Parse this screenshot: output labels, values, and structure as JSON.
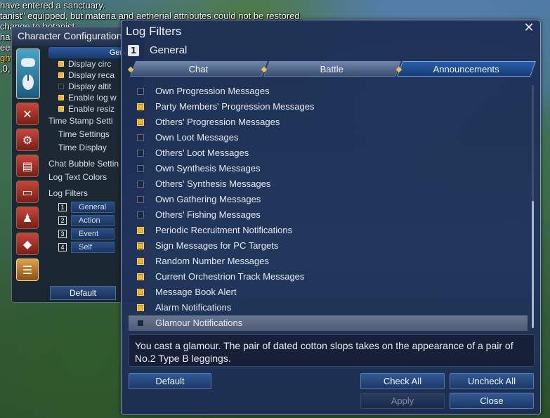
{
  "background_chat": [
    {
      "text": "have entered a sanctuary.",
      "warn": false
    },
    {
      "text": "tanist\" equipped, but materia and aetherial attributes could not be restored.",
      "warn": false
    },
    {
      "text": "change to botanist.",
      "warn": false
    },
    {
      "text": "ha",
      "warn": false
    },
    {
      "text": "eer",
      "warn": false
    },
    {
      "text": "ght",
      "warn": true
    },
    {
      "text": ",0,",
      "warn": false
    }
  ],
  "character_config": {
    "title": "Character Configuration",
    "general_tab": "General",
    "options": [
      {
        "label": "Display circ",
        "checked": true
      },
      {
        "label": "Display reca",
        "checked": true
      },
      {
        "label": "Display altit",
        "checked": false
      },
      {
        "label": "Enable log w",
        "checked": true
      },
      {
        "label": "Enable resiz",
        "checked": true
      }
    ],
    "time_stamp_section": "Time Stamp Setti",
    "time_settings": "Time Settings",
    "time_display": "Time Display",
    "chat_bubble": "Chat Bubble Settin",
    "log_text_colors": "Log Text Colors",
    "log_filters_label": "Log Filters",
    "filters": [
      {
        "num": "1",
        "label": "General"
      },
      {
        "num": "2",
        "label": "Action"
      },
      {
        "num": "3",
        "label": "Event"
      },
      {
        "num": "4",
        "label": "Self"
      }
    ],
    "default_button": "Default",
    "icons": [
      "gamepad-icon",
      "mouse-icon",
      "crossed-swords-icon",
      "gears-icon",
      "id-card-icon",
      "window-icon",
      "character-icon",
      "dice-icon",
      "chat-bubble-icon"
    ]
  },
  "log_filters": {
    "title": "Log Filters",
    "close_symbol": "✕",
    "filter_number": "1",
    "filter_name": "General",
    "tabs": [
      {
        "label": "Chat",
        "active": false
      },
      {
        "label": "Battle",
        "active": false
      },
      {
        "label": "Announcements",
        "active": true
      }
    ],
    "items": [
      {
        "label": "Own Progression Messages",
        "checked": false,
        "highlight": false
      },
      {
        "label": "Party Members' Progression Messages",
        "checked": true,
        "highlight": false
      },
      {
        "label": "Others' Progression Messages",
        "checked": true,
        "highlight": false
      },
      {
        "label": "Own Loot Messages",
        "checked": false,
        "highlight": false
      },
      {
        "label": "Others' Loot Messages",
        "checked": false,
        "highlight": false
      },
      {
        "label": "Own Synthesis Messages",
        "checked": false,
        "highlight": false
      },
      {
        "label": "Others' Synthesis Messages",
        "checked": false,
        "highlight": false
      },
      {
        "label": "Own Gathering Messages",
        "checked": false,
        "highlight": false
      },
      {
        "label": "Others' Fishing Messages",
        "checked": false,
        "highlight": false
      },
      {
        "label": "Periodic Recruitment Notifications",
        "checked": true,
        "highlight": false
      },
      {
        "label": "Sign Messages for PC Targets",
        "checked": true,
        "highlight": false
      },
      {
        "label": "Random Number Messages",
        "checked": true,
        "highlight": false
      },
      {
        "label": "Current Orchestrion Track Messages",
        "checked": true,
        "highlight": false
      },
      {
        "label": "Message Book Alert",
        "checked": true,
        "highlight": false
      },
      {
        "label": "Alarm Notifications",
        "checked": true,
        "highlight": false
      },
      {
        "label": "Glamour Notifications",
        "checked": false,
        "highlight": true
      }
    ],
    "description": "You cast a glamour. The pair of dated cotton slops takes on the appearance of a pair of No.2 Type B leggings.",
    "buttons": {
      "default": "Default",
      "check_all": "Check All",
      "uncheck_all": "Uncheck All",
      "apply": "Apply",
      "close": "Close"
    }
  }
}
